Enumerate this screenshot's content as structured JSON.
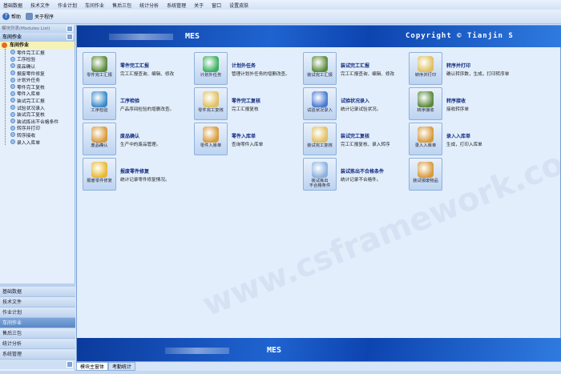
{
  "menu": [
    "基础数据",
    "技术文件",
    "作业计划",
    "车间作业",
    "售后三包",
    "统计分析",
    "系统管理",
    "关于",
    "窗口",
    "设置皮肤"
  ],
  "toolbar": {
    "help": "帮助",
    "about": "关于程序"
  },
  "left": {
    "modules_title": "模块列表(Modules List)",
    "group": "车间作业",
    "root": "车间作业",
    "items": [
      "零件完工汇报",
      "工序检验",
      "废品确认",
      "报废零件修复",
      "计划外任务",
      "零件完工复核",
      "零件入库单",
      "装试完工汇报",
      "试验状况录入",
      "装试完工复核",
      "装试拣出不合格条件",
      "转序并打印",
      "转序接收",
      "录入入库单"
    ],
    "sections": [
      "基础数据",
      "技术文件",
      "作业计划",
      "车间作业",
      "售后三包",
      "统计分析",
      "系统管理"
    ],
    "selected_section": "车间作业"
  },
  "banner": {
    "mes": "MES",
    "copyright": "Copyright © Tianjin S"
  },
  "tiles": [
    {
      "label": "零件完工汇报",
      "title": "零件完工汇报",
      "desc": "完工汇报查询、编辑、修改",
      "color": "#5a8a3a"
    },
    {
      "label": "工序检验",
      "title": "工序检验",
      "desc": "产品序间检验的增删改查。",
      "color": "#3a8ac8"
    },
    {
      "label": "废品确认",
      "title": "废品确认",
      "desc": "生产中的废品管理。",
      "color": "#d89a3a"
    },
    {
      "label": "报废零件修复",
      "title": "报废零件修复",
      "desc": "统计记录零件修复情况。",
      "color": "#e8b830"
    },
    {
      "label": "计划外任务",
      "title": "计划外任务",
      "desc": "管理计划外任务的增删改查。",
      "color": "#3ab060"
    },
    {
      "label": "零件完工复核",
      "title": "零件完工复核",
      "desc": "完工汇报复核",
      "color": "#e0c060"
    },
    {
      "label": "零件入库单",
      "title": "零件入库单",
      "desc": "查询零件入库单",
      "color": "#d89a3a"
    },
    {
      "label": "装试完工汇报",
      "title": "装试完工汇报",
      "desc": "完工汇报查询、编辑、修改",
      "color": "#5a8a3a"
    },
    {
      "label": "试验状况录入",
      "title": "试验状况录入",
      "desc": "统计记录试验状况。",
      "color": "#4a7ad0"
    },
    {
      "label": "装试完工复核",
      "title": "装试完工复核",
      "desc": "完工汇报复核、录入转序",
      "color": "#e0c060"
    },
    {
      "label": "装试拣出\n不合格条件",
      "title": "装试拣出不合格条件",
      "desc": "统计记录不合格件。",
      "color": "#8ab0e0"
    },
    {
      "label": "转序并打印",
      "title": "转序并打印",
      "desc": "确认转序数，生成，打印转序单",
      "color": "#e0c060"
    },
    {
      "label": "转序接收",
      "title": "转序接收",
      "desc": "接收转序单",
      "color": "#5a8a3a"
    },
    {
      "label": "录入入库单",
      "title": "录入入库单",
      "desc": "生成，打印入库单",
      "color": "#d89a3a"
    },
    {
      "label": "装试报废物品",
      "title": "",
      "desc": "",
      "color": "#d89a3a"
    }
  ],
  "tabs": [
    "模块主窗体",
    "考勤统计"
  ]
}
